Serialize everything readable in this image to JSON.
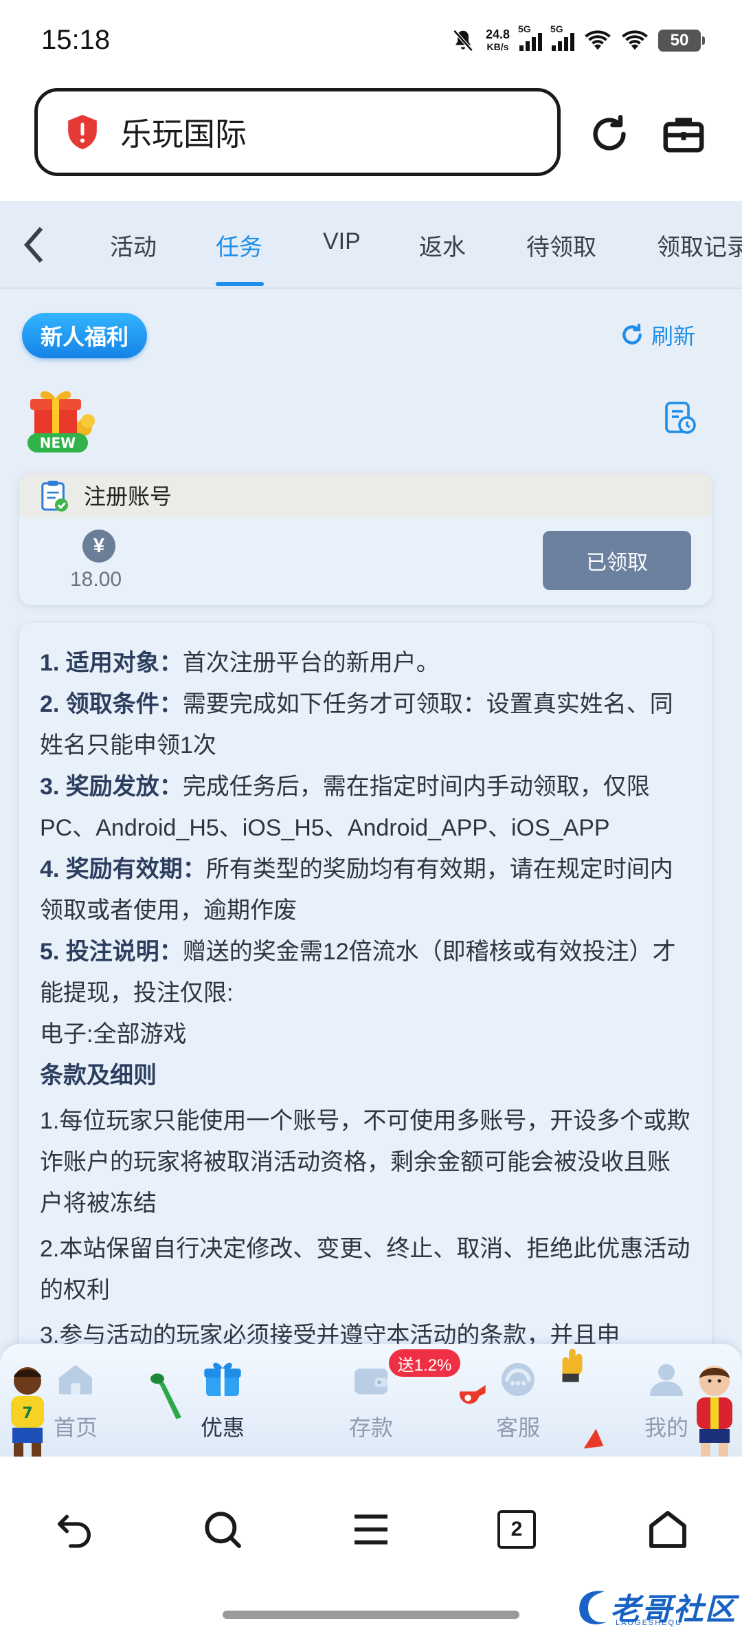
{
  "status_bar": {
    "time": "15:18",
    "net_speed": "24.8",
    "net_unit": "KB/s",
    "sim1": "5G",
    "sim2": "5G",
    "battery": "50"
  },
  "browser": {
    "url_title": "乐玩国际"
  },
  "tabs": {
    "items": [
      "活动",
      "任务",
      "VIP",
      "返水",
      "待领取",
      "领取记录"
    ],
    "active": "任务",
    "accent": "#1f8ee8"
  },
  "header": {
    "badge": "新人福利",
    "refresh": "刷新"
  },
  "gift": {
    "new_label": "NEW"
  },
  "task": {
    "title": "注册账号",
    "currency_symbol": "¥",
    "amount": "18.00",
    "button": "已领取"
  },
  "rules": {
    "items": [
      {
        "label": "1. 适用对象：",
        "text": "首次注册平台的新用户。"
      },
      {
        "label": "2. 领取条件：",
        "text": "需要完成如下任务才可领取：设置真实姓名、同姓名只能申领1次"
      },
      {
        "label": "3. 奖励发放：",
        "text": "完成任务后，需在指定时间内手动领取，仅限PC、Android_H5、iOS_H5、Android_APP、iOS_APP"
      },
      {
        "label": "4. 奖励有效期：",
        "text": "所有类型的奖励均有有效期，请在规定时间内领取或者使用，逾期作废"
      },
      {
        "label": "5. 投注说明：",
        "text": "赠送的奖金需12倍流水（即稽核或有效投注）才能提现，投注仅限:"
      }
    ],
    "game_scope": "电子:全部游戏",
    "terms_heading": "条款及细则",
    "terms": [
      "1.每位玩家只能使用一个账号，不可使用多账号，开设多个或欺诈账户的玩家将被取消活动资格，剩余金额可能会被没收且账户将被冻结",
      "2.本站保留自行决定修改、变更、终止、取消、拒绝此优惠活动的权利",
      "3.参与活动的玩家必须接受并遵守本活动的条款，并且申"
    ]
  },
  "site_nav": {
    "items": [
      "首页",
      "优惠",
      "存款",
      "客服",
      "我的"
    ],
    "active": "优惠",
    "deposit_badge": "送1.2%"
  },
  "phone_nav": {
    "tab_count": "2"
  },
  "watermark": {
    "text": "老哥社区",
    "sub": "LAOGESHEQU"
  }
}
